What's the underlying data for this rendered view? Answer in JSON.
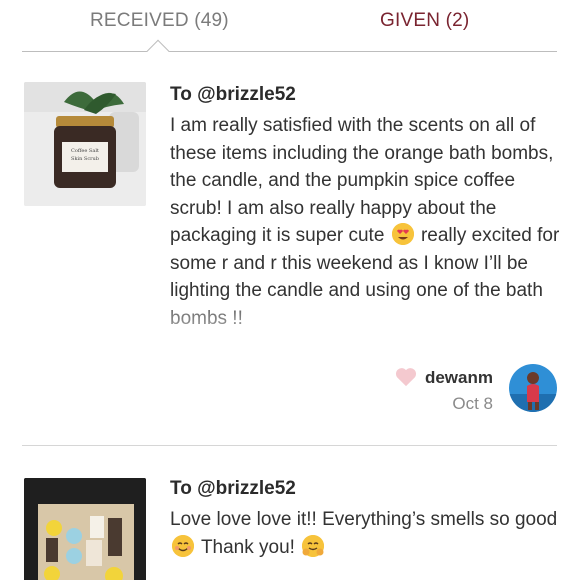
{
  "tabs": {
    "received_label": "RECEIVED (49)",
    "given_label": "GIVEN (2)"
  },
  "reviews": [
    {
      "recipient": "To @brizzle52",
      "text_before_emoji": "I am really satisfied with the scents on all of these items including the orange bath bombs, the candle, and the pumpkin spice coffee scrub! I am also really happy about the packaging it is super cute",
      "text_after_emoji": "really excited for some r and r this weekend as I know I’ll be lighting the candle and using one of the bath bombs !!",
      "emoji_icon": "heart-eyes-emoji",
      "reviewer": "dewanm",
      "date": "Oct 8",
      "thumb_label": "Coffee Salt Skin Scrub"
    },
    {
      "recipient": "To @brizzle52",
      "text_before_emoji": "Love love love it!! Everything’s smells so good",
      "emoji_icon": "smiling-emoji",
      "text_middle": "Thank you!",
      "emoji_icon_2": "hugging-emoji"
    }
  ],
  "colors": {
    "given_tab": "#7a2430",
    "received_tab": "#7b7b7b",
    "heart": "#f4c9cf"
  }
}
